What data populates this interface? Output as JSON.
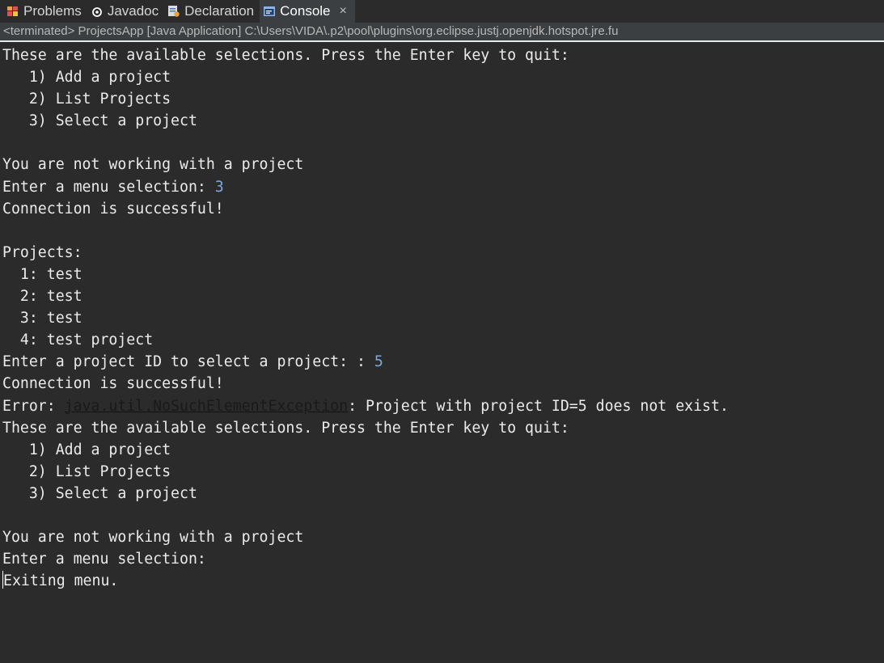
{
  "tabs": [
    {
      "label": "Problems",
      "icon": "problems-icon"
    },
    {
      "label": "Javadoc",
      "icon": "javadoc-icon"
    },
    {
      "label": "Declaration",
      "icon": "declaration-icon"
    },
    {
      "label": "Console",
      "icon": "console-icon",
      "close": "×"
    }
  ],
  "header": {
    "status": "<terminated> ProjectsApp [Java Application] C:\\Users\\VIDA\\.p2\\pool\\plugins\\org.eclipse.justj.openjdk.hotspot.jre.fu"
  },
  "console": {
    "l1": "These are the available selections. Press the Enter key to quit:",
    "l2": "   1) Add a project",
    "l3": "   2) List Projects",
    "l4": "   3) Select a project",
    "l5": "",
    "l6": "You are not working with a project",
    "l7_prefix": "Enter a menu selection: ",
    "l7_input": "3",
    "l8": "Connection is successful!",
    "l9": "",
    "l10": "Projects:",
    "l11": "  1: test",
    "l12": "  2: test",
    "l13": "  3: test",
    "l14": "  4: test project",
    "l15_prefix": "Enter a project ID to select a project: : ",
    "l15_input": "5",
    "l16": "Connection is successful!",
    "l17_prefix": "Error: ",
    "l17_link": "java.util.NoSuchElementException",
    "l17_suffix": ": Project with project ID=5 does not exist.",
    "l18": "These are the available selections. Press the Enter key to quit:",
    "l19": "   1) Add a project",
    "l20": "   2) List Projects",
    "l21": "   3) Select a project",
    "l22": "",
    "l23": "You are not working with a project",
    "l24": "Enter a menu selection: ",
    "l25": "Exiting menu."
  },
  "colors": {
    "background": "#2b2b2b",
    "text": "#ebebeb",
    "user_input": "#7fa7d9",
    "link": "#1a1a1a"
  }
}
